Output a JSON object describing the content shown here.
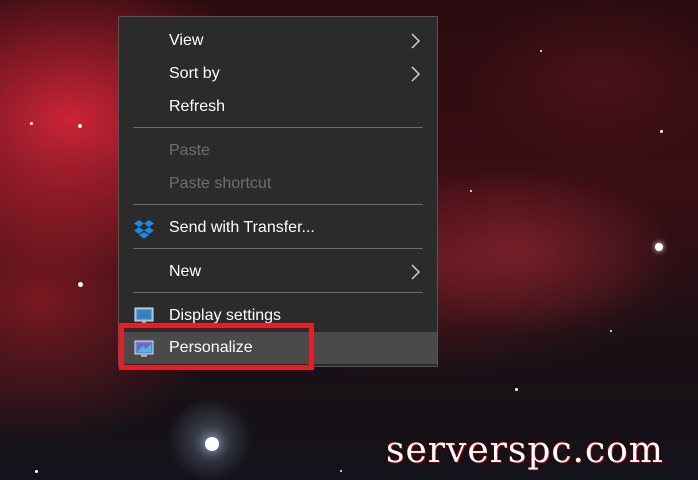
{
  "context_menu": {
    "items": {
      "view": "View",
      "sort_by": "Sort by",
      "refresh": "Refresh",
      "paste": "Paste",
      "paste_shortcut": "Paste shortcut",
      "send_with_transfer": "Send with Transfer...",
      "new": "New",
      "display_settings": "Display settings",
      "personalize": "Personalize"
    }
  },
  "watermark": "serverspc.com",
  "colors": {
    "menu_bg": "#2b2b2b",
    "highlight_bg": "#4a4a4a",
    "annotation_red": "#e3202a",
    "disabled_text": "#6f6f6f"
  }
}
